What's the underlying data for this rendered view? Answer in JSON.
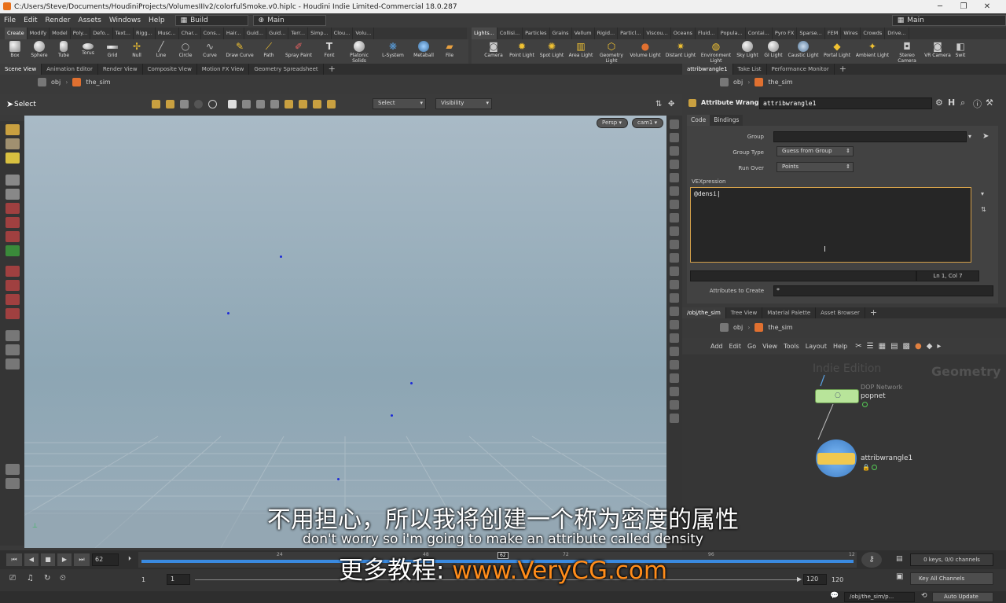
{
  "window": {
    "title": "C:/Users/Steve/Documents/HoudiniProjects/VolumesIIIv2/colorfulSmoke.v0.hiplc - Houdini Indie Limited-Commercial 18.0.287",
    "minimize": "─",
    "restore": "❐",
    "close": "✕"
  },
  "menu": {
    "items": [
      "File",
      "Edit",
      "Render",
      "Assets",
      "Windows",
      "Help"
    ],
    "desktop": "Build",
    "context": "Main",
    "right_desktop": "Main"
  },
  "shelf_tabs_left": [
    "Create",
    "Modify",
    "Model",
    "Poly...",
    "Defo...",
    "Text...",
    "Rigg...",
    "Musc...",
    "Char...",
    "Cons...",
    "Hair...",
    "Guid...",
    "Guid...",
    "Terr...",
    "Simp...",
    "Clou...",
    "Volu..."
  ],
  "shelf_tabs_right": [
    "Lights...",
    "Collisi...",
    "Particles",
    "Grains",
    "Vellum",
    "Rigid...",
    "Particl...",
    "Viscou...",
    "Oceans",
    "Fluid...",
    "Popula...",
    "Contai...",
    "Pyro FX",
    "Sparse...",
    "FEM",
    "Wires",
    "Crowds",
    "Drive..."
  ],
  "shelf_tools_left": [
    "Box",
    "Sphere",
    "Tube",
    "Torus",
    "Grid",
    "Null",
    "Line",
    "Circle",
    "Curve",
    "Draw Curve",
    "Path",
    "Spray Paint",
    "Font",
    "Platonic Solids",
    "L-System",
    "Metaball",
    "File"
  ],
  "shelf_tools_right": [
    "Camera",
    "Point Light",
    "Spot Light",
    "Area Light",
    "Geometry Light",
    "Volume Light",
    "Distant Light",
    "Environment Light",
    "Sky Light",
    "GI Light",
    "Caustic Light",
    "Portal Light",
    "Ambient Light",
    "Stereo Camera",
    "VR Camera",
    "Swit"
  ],
  "left_pane": {
    "tabs": [
      "Scene View",
      "Animation Editor",
      "Render View",
      "Composite View",
      "Motion FX View",
      "Geometry Spreadsheet"
    ],
    "path_root": "obj",
    "path_node": "the_sim",
    "select_label": "Select",
    "select_dropdown": "Select",
    "visibility_dropdown": "Visibility",
    "persp": "Persp ▾",
    "cam": "cam1 ▾"
  },
  "param_pane": {
    "tabs": [
      "attribwrangle1",
      "Take List",
      "Performance Monitor"
    ],
    "path_root": "obj",
    "path_node": "the_sim",
    "node_type": "Attribute Wrangle",
    "node_name": "attribwrangle1",
    "sub_tabs": [
      "Code",
      "Bindings"
    ],
    "group_label": "Group",
    "group_type_label": "Group Type",
    "group_type_value": "Guess from Group",
    "run_over_label": "Run Over",
    "run_over_value": "Points",
    "vex_label": "VEXpression",
    "vex_code": "@densi",
    "cursor_pos": "Ln 1, Col 7",
    "attrs_label": "Attributes to Create",
    "attrs_value": "*"
  },
  "net_pane": {
    "tabs": [
      "/obj/the_sim",
      "Tree View",
      "Material Palette",
      "Asset Browser"
    ],
    "path_root": "obj",
    "path_node": "the_sim",
    "menu": [
      "Add",
      "Edit",
      "Go",
      "View",
      "Tools",
      "Layout",
      "Help"
    ],
    "watermark": "Indie Edition",
    "context_label": "Geometry",
    "node1_type": "DOP Network",
    "node1_name": "popnet",
    "node2_name": "attribwrangle1"
  },
  "timeline": {
    "frame": "62",
    "ticks": [
      "24",
      "48",
      "62",
      "72",
      "96",
      "12"
    ],
    "keys": "0 keys, 0/0 channels",
    "start": "1",
    "start2": "1",
    "end": "120",
    "end2": "120",
    "key_all": "Key All Channels",
    "auto_update": "Auto Update",
    "status_path": "/obj/the_sim/p..."
  },
  "subtitles": {
    "zh": "不用担心，所以我将创建一个称为密度的属性",
    "en": "don't worry so i'm going to make an attribute called density",
    "promo_prefix": "更多教程: ",
    "promo_url": "www.VeryCG.com"
  }
}
